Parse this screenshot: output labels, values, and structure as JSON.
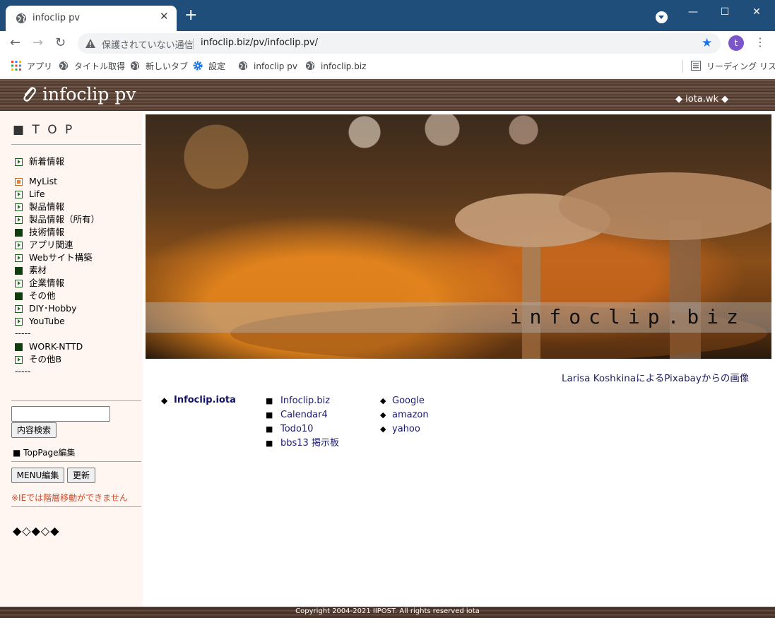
{
  "browser": {
    "tab_title": "infoclip pv",
    "tab_close": "✕",
    "new_tab": "+",
    "profile_dropdown_icon": "chevron-down",
    "window_controls": {
      "minimize": "—",
      "maximize": "☐",
      "close": "✕"
    },
    "nav": {
      "back": "←",
      "forward": "→",
      "reload": "↻"
    },
    "security_text": "保護されていない通信",
    "url": "infoclip.biz/pv/infoclip.pv/",
    "star": "★",
    "avatar_letter": "t",
    "menu": "⋮",
    "bookmarks": [
      {
        "label": "アプリ",
        "icon": "apps-grid-icon"
      },
      {
        "label": "タイトル取得",
        "icon": "globe-icon"
      },
      {
        "label": "新しいタブ",
        "icon": "globe-icon"
      },
      {
        "label": "設定",
        "icon": "gear-icon"
      },
      {
        "label": "infoclip pv",
        "icon": "globe-icon"
      },
      {
        "label": "infoclip.biz",
        "icon": "globe-icon"
      }
    ],
    "reading_list": "リーディング リスト"
  },
  "header": {
    "site_title": "infoclip pv",
    "right_link": "◆ iota.wk ◆"
  },
  "sidebar": {
    "top_heading": "■ T O P",
    "news_item": "新着情報",
    "items": [
      {
        "label": "MyList",
        "icon": "orange"
      },
      {
        "label": "Life",
        "icon": "green"
      },
      {
        "label": "製品情報",
        "icon": "green"
      },
      {
        "label": "製品情報（所有）",
        "icon": "green"
      },
      {
        "label": "技術情報",
        "icon": "dark"
      },
      {
        "label": "アプリ関連",
        "icon": "green"
      },
      {
        "label": "Webサイト構築",
        "icon": "green"
      },
      {
        "label": "素材",
        "icon": "dark"
      },
      {
        "label": "企業情報",
        "icon": "green"
      },
      {
        "label": "その他",
        "icon": "dark"
      },
      {
        "label": "DIY･Hobby",
        "icon": "green"
      },
      {
        "label": "YouTube",
        "icon": "green"
      }
    ],
    "separator": "-----",
    "items_b": [
      {
        "label": "WORK-NTTD",
        "icon": "dark"
      },
      {
        "label": "その他B",
        "icon": "green"
      }
    ],
    "search_placeholder": "",
    "search_button": "内容検索",
    "toppage_edit": "■ TopPage編集",
    "menu_edit_button": "MENU編集",
    "refresh_button": "更新",
    "ie_note": "※IEでは階層移動ができません",
    "diamond_row": "◆◇◆◇◆"
  },
  "main": {
    "hero_caption": "infoclip.biz",
    "credit": "Larisa KoshkinaによるPixabayからの画像",
    "main_link": "Infoclip.iota",
    "links_col1": [
      "Infoclip.biz",
      "Calendar4",
      "Todo10",
      "bbs13 掲示板"
    ],
    "links_col2": [
      "Google",
      "amazon",
      "yahoo"
    ]
  },
  "footer": {
    "copyright": "Copyright 2004-2021 IIPOST. All rights reserved iota"
  }
}
